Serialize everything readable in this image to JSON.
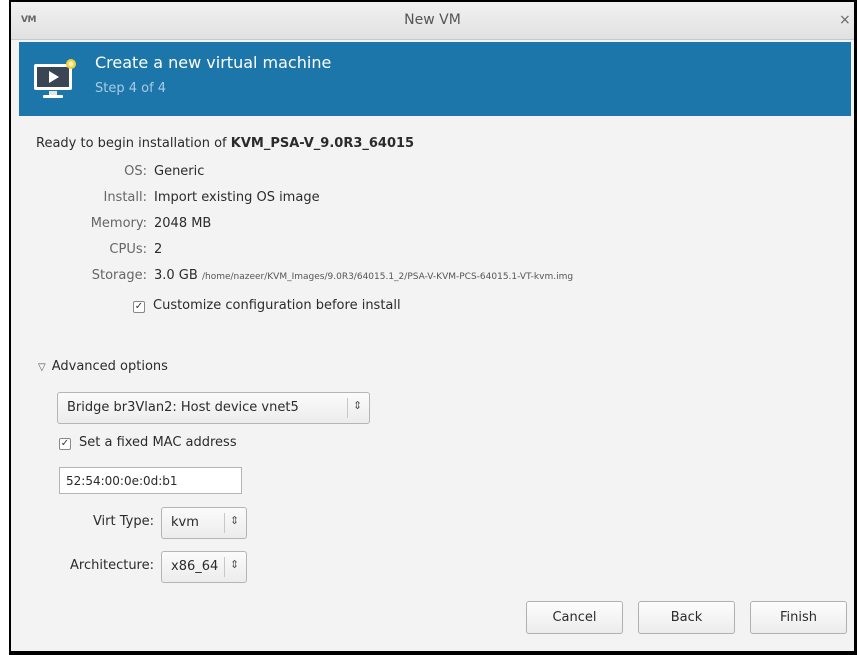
{
  "window": {
    "app_icon_text": "VM",
    "title": "New VM",
    "close_symbol": "×"
  },
  "banner": {
    "title": "Create a new virtual machine",
    "step": "Step 4 of 4",
    "icon": "monitor-icon",
    "color": "#1d76a9"
  },
  "summary": {
    "ready_prefix": "Ready to begin installation of",
    "vm_name": "KVM_PSA-V_9.0R3_64015",
    "os_label": "OS:",
    "os_value": "Generic",
    "install_label": "Install:",
    "install_value": "Import existing OS image",
    "memory_label": "Memory:",
    "memory_value": "2048 MB",
    "cpus_label": "CPUs:",
    "cpus_value": "2",
    "storage_label": "Storage:",
    "storage_size": "3.0 GB",
    "storage_path": "/home/nazeer/KVM_Images/9.0R3/64015.1_2/PSA-V-KVM-PCS-64015.1-VT-kvm.img",
    "customize_label": "Customize configuration before install",
    "customize_checked": true
  },
  "advanced": {
    "label": "Advanced options",
    "expanded": true,
    "network_source": "Bridge br3Vlan2: Host device vnet5",
    "mac_checkbox_label": "Set a fixed MAC address",
    "mac_checked": true,
    "mac_value": "52:54:00:0e:0d:b1",
    "virt_type_label": "Virt Type:",
    "virt_type_value": "kvm",
    "arch_label": "Architecture:",
    "arch_value": "x86_64"
  },
  "buttons": {
    "cancel": "Cancel",
    "back": "Back",
    "finish": "Finish"
  },
  "glyphs": {
    "check": "✓",
    "updown": "⇕",
    "expander": "▽"
  }
}
